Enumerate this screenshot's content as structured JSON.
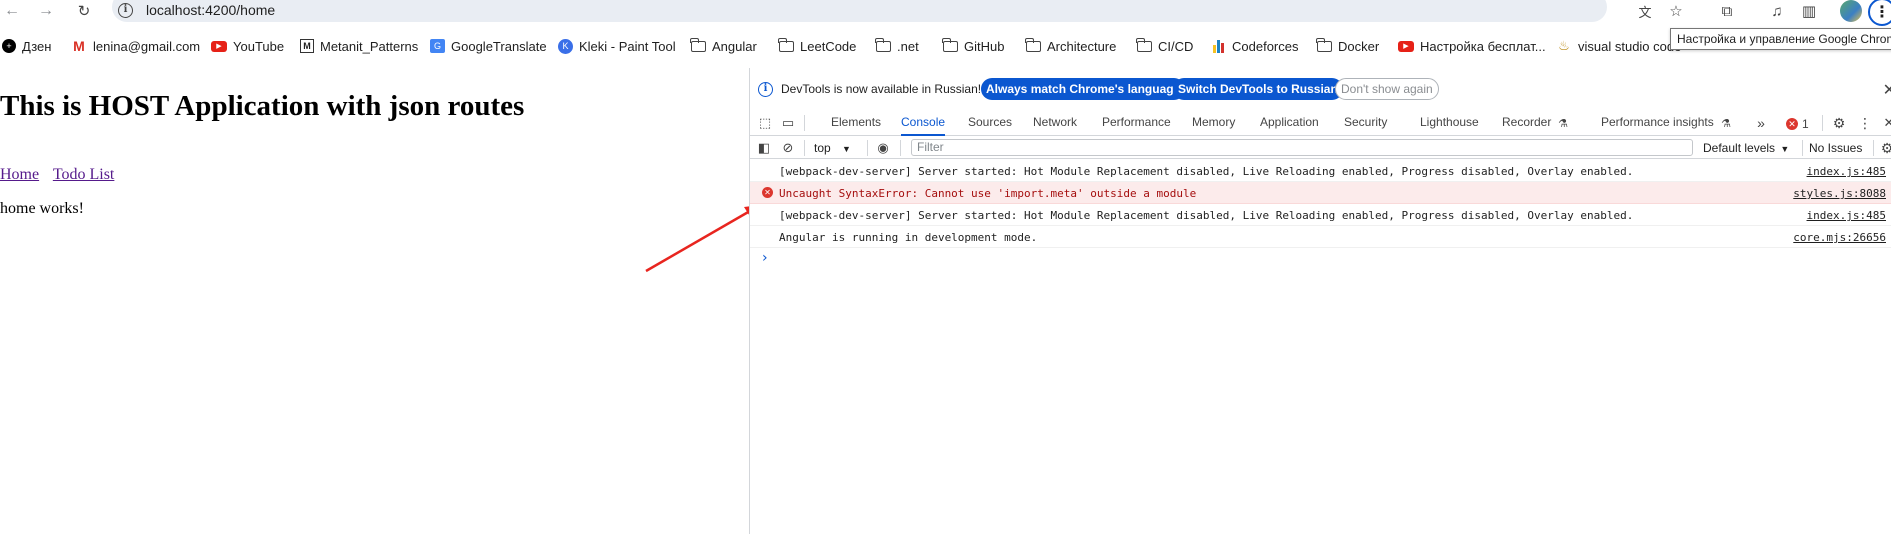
{
  "browser": {
    "url": "localhost:4200/home",
    "tooltip": "Настройка и управление Google Chrome"
  },
  "bookmarks": [
    {
      "label": "Дзен",
      "icon": "dzen-icon"
    },
    {
      "label": "lenina@gmail.com",
      "icon": "gmail-icon"
    },
    {
      "label": "YouTube",
      "icon": "youtube-icon"
    },
    {
      "label": "Metanit_Patterns",
      "icon": "metanit-icon"
    },
    {
      "label": "GoogleTranslate",
      "icon": "google-translate-icon"
    },
    {
      "label": "Kleki - Paint Tool",
      "icon": "kleki-icon"
    },
    {
      "label": "Angular",
      "icon": "folder-icon"
    },
    {
      "label": "LeetCode",
      "icon": "folder-icon"
    },
    {
      "label": ".net",
      "icon": "folder-icon"
    },
    {
      "label": "GitHub",
      "icon": "folder-icon"
    },
    {
      "label": "Architecture",
      "icon": "folder-icon"
    },
    {
      "label": "CI/CD",
      "icon": "folder-icon"
    },
    {
      "label": "Codeforces",
      "icon": "codeforces-icon"
    },
    {
      "label": "Docker",
      "icon": "folder-icon"
    },
    {
      "label": "Настройка бесплат...",
      "icon": "youtube-icon"
    },
    {
      "label": "visual studio code",
      "icon": "visual-studio-code-icon"
    }
  ],
  "page": {
    "title": "This is HOST Application with json routes",
    "nav": [
      "Home",
      "Todo List"
    ],
    "body": "home works!"
  },
  "devtools": {
    "infobar": {
      "text": "DevTools is now available in Russian!",
      "match_button": "Always match Chrome's language",
      "switch_button": "Switch DevTools to Russian",
      "dismiss_button": "Don't show again"
    },
    "tabs": [
      "Elements",
      "Console",
      "Sources",
      "Network",
      "Performance",
      "Memory",
      "Application",
      "Security",
      "Lighthouse",
      "Recorder",
      "Performance insights"
    ],
    "active_tab": "Console",
    "error_count": "1",
    "toolbar": {
      "context": "top",
      "filter_placeholder": "Filter",
      "levels": "Default levels",
      "issues": "No Issues"
    },
    "console": [
      {
        "level": "info",
        "message": "[webpack-dev-server] Server started: Hot Module Replacement disabled, Live Reloading enabled, Progress disabled, Overlay enabled.",
        "source": "index.js:485"
      },
      {
        "level": "error",
        "message": "Uncaught SyntaxError: Cannot use 'import.meta' outside a module",
        "source": "styles.js:8088"
      },
      {
        "level": "info",
        "message": "[webpack-dev-server] Server started: Hot Module Replacement disabled, Live Reloading enabled, Progress disabled, Overlay enabled.",
        "source": "index.js:485"
      },
      {
        "level": "info",
        "message": "Angular is running in development mode.",
        "source": "core.mjs:26656"
      }
    ]
  },
  "colors": {
    "accent": "#0b57d0",
    "error": "#dc362e",
    "error_bg": "#fcebeb",
    "annotation_arrow": "#e8251f"
  }
}
